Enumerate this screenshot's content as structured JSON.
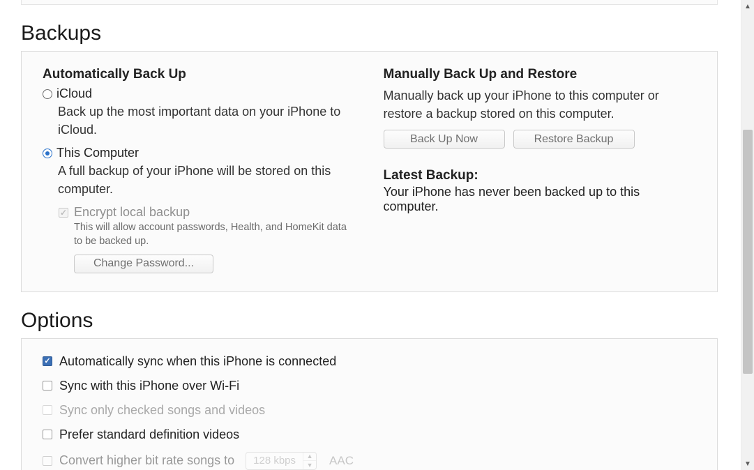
{
  "backups": {
    "title": "Backups",
    "auto": {
      "heading": "Automatically Back Up",
      "icloud": {
        "label": "iCloud",
        "desc": "Back up the most important data on your iPhone to iCloud.",
        "selected": false
      },
      "computer": {
        "label": "This Computer",
        "desc": "A full backup of your iPhone will be stored on this computer.",
        "selected": true
      },
      "encrypt": {
        "label": "Encrypt local backup",
        "desc": "This will allow account passwords, Health, and HomeKit data to be backed up.",
        "change_password_label": "Change Password..."
      }
    },
    "manual": {
      "heading": "Manually Back Up and Restore",
      "desc": "Manually back up your iPhone to this computer or restore a backup stored on this computer.",
      "backup_now_label": "Back Up Now",
      "restore_label": "Restore Backup"
    },
    "latest": {
      "heading": "Latest Backup:",
      "desc": "Your iPhone has never been backed up to this computer."
    }
  },
  "options": {
    "title": "Options",
    "auto_sync": {
      "label": "Automatically sync when this iPhone is connected",
      "checked": true
    },
    "wifi_sync": {
      "label": "Sync with this iPhone over Wi-Fi",
      "checked": false
    },
    "checked_only": {
      "label": "Sync only checked songs and videos",
      "checked": false,
      "disabled": true
    },
    "sd_videos": {
      "label": "Prefer standard definition videos",
      "checked": false
    },
    "bitrate": {
      "label": "Convert higher bit rate songs to",
      "value": "128 kbps",
      "suffix": "AAC",
      "checked": false
    }
  }
}
